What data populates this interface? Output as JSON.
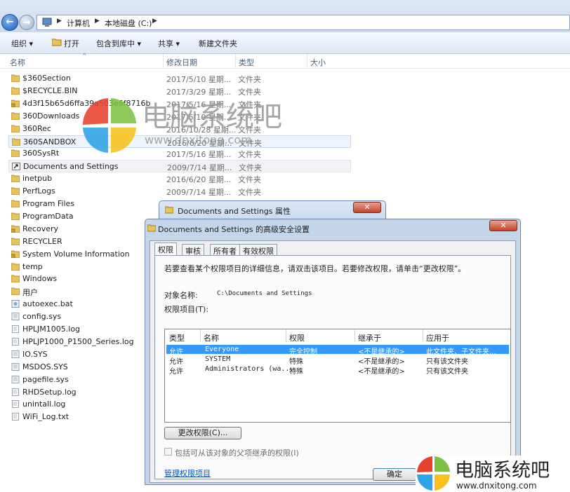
{
  "address": {
    "crumbs": [
      "计算机",
      "本地磁盘 (C:)"
    ]
  },
  "toolbar": {
    "organize": "组织 ▾",
    "open": "打开",
    "include": "包含到库中 ▾",
    "share": "共享 ▾",
    "new_folder": "新建文件夹"
  },
  "columns": {
    "name": "名称",
    "date": "修改日期",
    "type": "类型",
    "size": "大小"
  },
  "files": [
    {
      "name": "$360Section",
      "date": "2017/5/10 星期...",
      "type": "文件夹",
      "icon": "folder-icon"
    },
    {
      "name": "$RECYCLE.BIN",
      "date": "2017/3/29 星期...",
      "type": "文件夹",
      "icon": "folder-icon"
    },
    {
      "name": "4d3f15b65d6ffa39a503e6f8716b",
      "date": "2017/5/16 星期...",
      "type": "文件夹",
      "icon": "locked-folder-icon"
    },
    {
      "name": "360Downloads",
      "date": "2017/5/10 星期...",
      "type": "文件夹",
      "icon": "folder-icon"
    },
    {
      "name": "360Rec",
      "date": "2016/10/28 星期...",
      "type": "文件夹",
      "icon": "folder-icon"
    },
    {
      "name": "360SANDBOX",
      "date": "2016/6/20 星期...",
      "type": "文件夹",
      "icon": "folder-icon"
    },
    {
      "name": "360SysRt",
      "date": "2017/5/16 星期...",
      "type": "文件夹",
      "icon": "folder-icon"
    },
    {
      "name": "Documents and Settings",
      "date": "2009/7/14 星期...",
      "type": "文件夹",
      "icon": "shortcut-folder-icon"
    },
    {
      "name": "inetpub",
      "date": "2016/6/20 星期...",
      "type": "文件夹",
      "icon": "folder-icon"
    },
    {
      "name": "PerfLogs",
      "date": "2009/7/14 星期...",
      "type": "文件夹",
      "icon": "folder-icon"
    },
    {
      "name": "Program Files",
      "date": "",
      "type": "",
      "icon": "folder-icon"
    },
    {
      "name": "ProgramData",
      "date": "",
      "type": "",
      "icon": "folder-icon"
    },
    {
      "name": "Recovery",
      "date": "",
      "type": "",
      "icon": "locked-folder-icon"
    },
    {
      "name": "RECYCLER",
      "date": "",
      "type": "",
      "icon": "folder-icon"
    },
    {
      "name": "System Volume Information",
      "date": "",
      "type": "",
      "icon": "locked-folder-icon"
    },
    {
      "name": "temp",
      "date": "",
      "type": "",
      "icon": "folder-icon"
    },
    {
      "name": "Windows",
      "date": "",
      "type": "",
      "icon": "folder-icon"
    },
    {
      "name": "用户",
      "date": "",
      "type": "",
      "icon": "folder-icon"
    },
    {
      "name": "autoexec.bat",
      "date": "",
      "type": "",
      "icon": "bat-file-icon"
    },
    {
      "name": "config.sys",
      "date": "",
      "type": "",
      "icon": "sys-file-icon"
    },
    {
      "name": "HPLJM1005.log",
      "date": "",
      "type": "",
      "icon": "text-file-icon"
    },
    {
      "name": "HPLJP1000_P1500_Series.log",
      "date": "",
      "type": "",
      "icon": "text-file-icon"
    },
    {
      "name": "IO.SYS",
      "date": "",
      "type": "",
      "icon": "sys-file-icon"
    },
    {
      "name": "MSDOS.SYS",
      "date": "",
      "type": "",
      "icon": "sys-file-icon"
    },
    {
      "name": "pagefile.sys",
      "date": "",
      "type": "",
      "icon": "sys-file-icon"
    },
    {
      "name": "RHDSetup.log",
      "date": "",
      "type": "",
      "icon": "text-file-icon"
    },
    {
      "name": "unintall.log",
      "date": "",
      "type": "",
      "icon": "text-file-icon"
    },
    {
      "name": "WiFi_Log.txt",
      "date": "",
      "type": "",
      "icon": "text-file-icon"
    }
  ],
  "watermark": {
    "cn": "电脑系统吧",
    "url": "www.dnxitong.com"
  },
  "props_dialog": {
    "title": "Documents and Settings 属性"
  },
  "sec_dialog": {
    "title": "Documents and Settings 的高级安全设置",
    "tabs": [
      "权限",
      "审核",
      "所有者",
      "有效权限"
    ],
    "instruction": "若要查看某个权限项目的详细信息，请双击该项目。若要修改权限，请单击“更改权限”。",
    "object_label": "对象名称:",
    "object_value": "C:\\Documents and Settings",
    "entries_label": "权限项目(T):",
    "perm_headers": [
      "类型",
      "名称",
      "权限",
      "继承于",
      "应用于"
    ],
    "perm_rows": [
      {
        "type": "允许",
        "name": "Everyone",
        "perm": "完全控制",
        "inherit": "<不是继承的>",
        "apply": "此文件夹、子文件夹..."
      },
      {
        "type": "允许",
        "name": "SYSTEM",
        "perm": "特殊",
        "inherit": "<不是继承的>",
        "apply": "只有该文件夹"
      },
      {
        "type": "允许",
        "name": "Administrators (wa...",
        "perm": "特殊",
        "inherit": "<不是继承的>",
        "apply": "只有该文件夹"
      }
    ],
    "change_btn": "更改权限(C)...",
    "inherit_chk": "包括可从该对象的父项继承的权限(I)",
    "manage_link": "管理权限项目",
    "ok_btn": "确定"
  }
}
